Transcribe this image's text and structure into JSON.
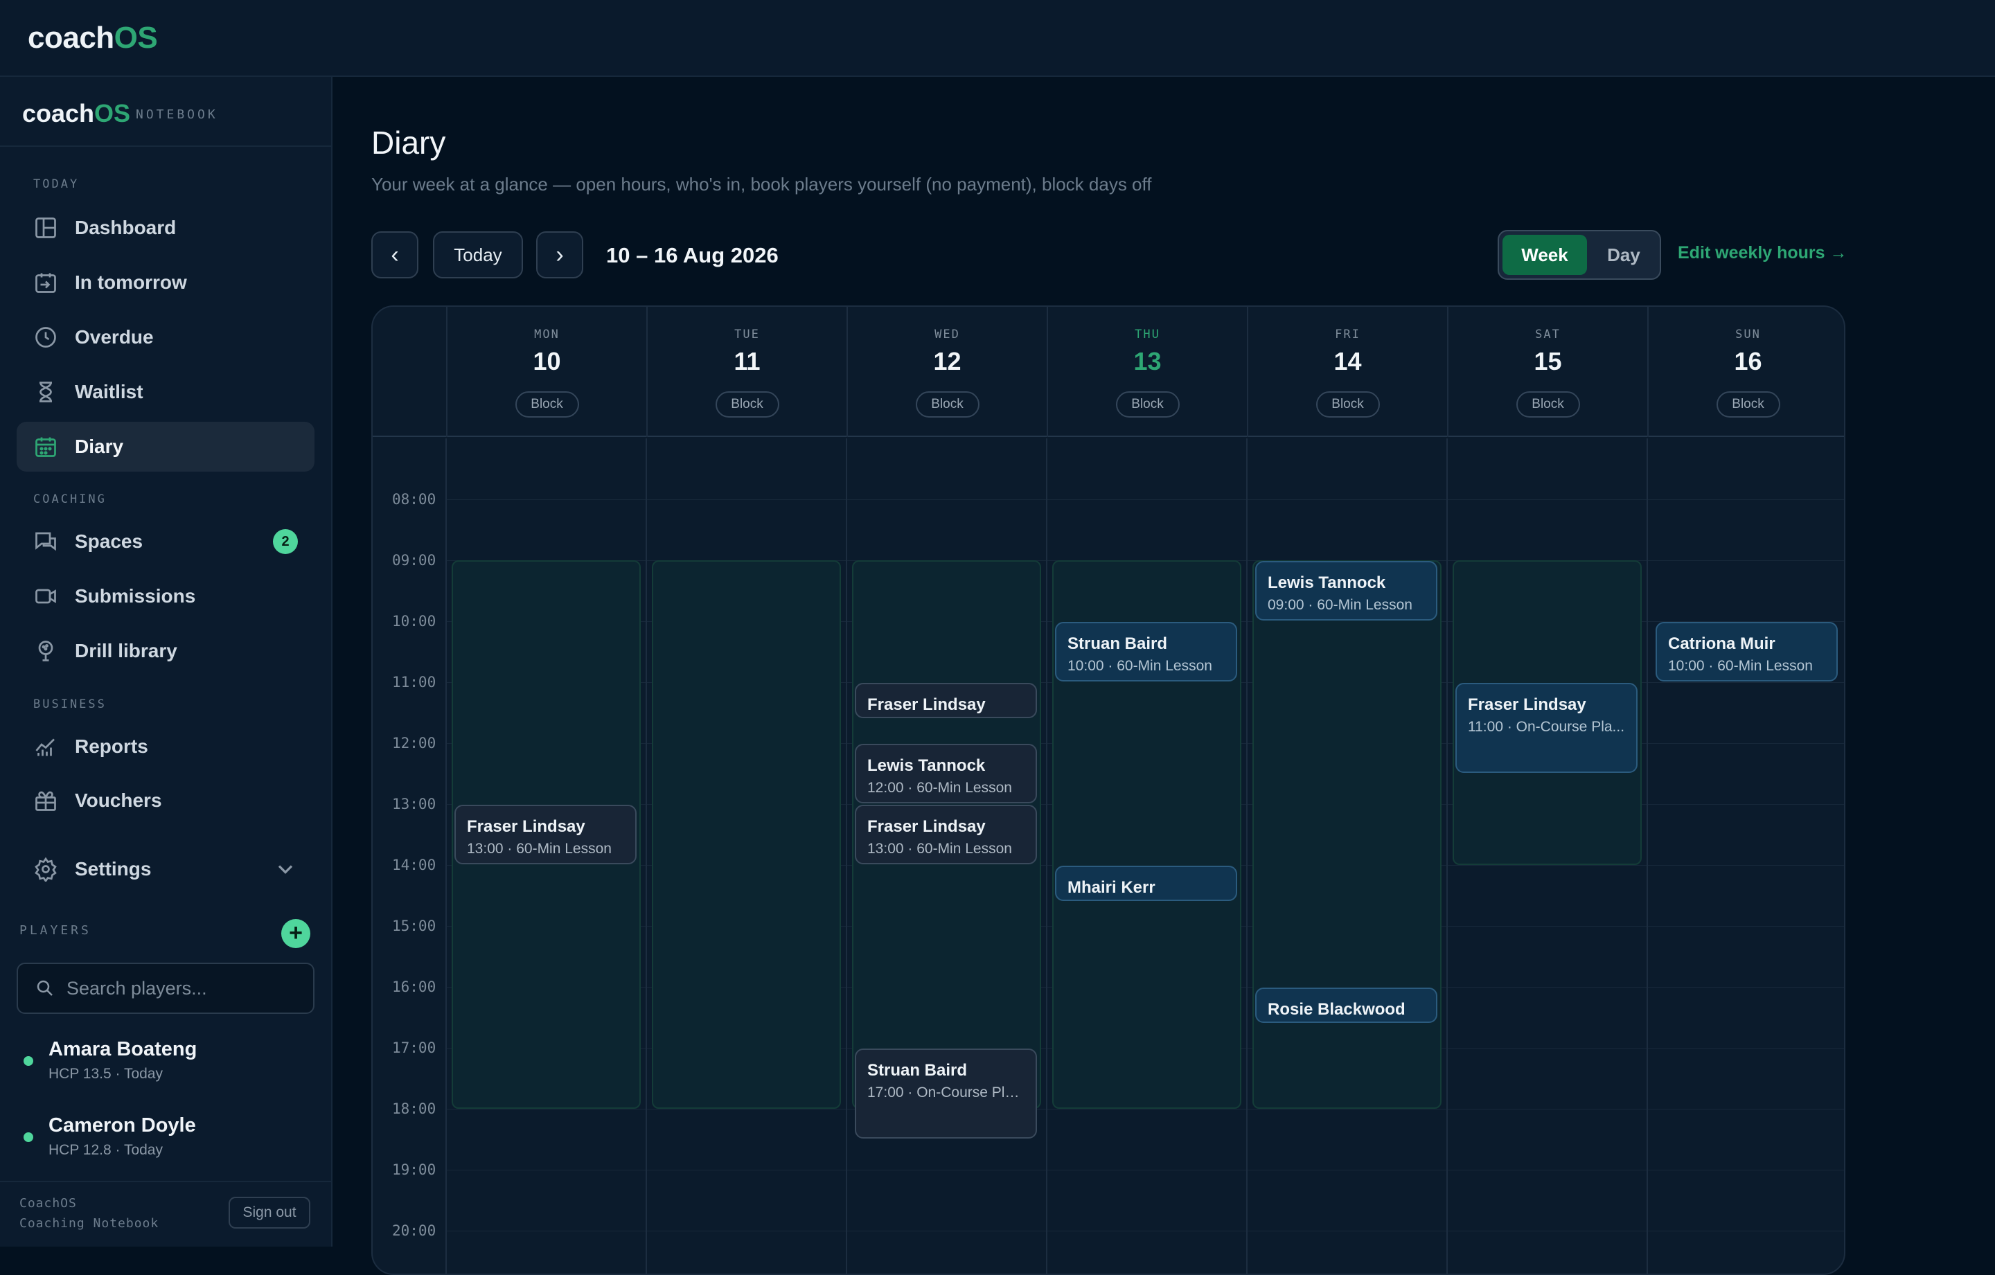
{
  "app": {
    "brand_prefix": "coach",
    "brand_suffix": "OS",
    "notebook_label": "NOTEBOOK"
  },
  "sidebar": {
    "sections": {
      "today": "TODAY",
      "coaching": "COACHING",
      "business": "BUSINESS"
    },
    "items": [
      {
        "label": "Dashboard"
      },
      {
        "label": "In tomorrow"
      },
      {
        "label": "Overdue"
      },
      {
        "label": "Waitlist"
      },
      {
        "label": "Diary"
      },
      {
        "label": "Spaces",
        "badge": "2"
      },
      {
        "label": "Submissions"
      },
      {
        "label": "Drill library"
      },
      {
        "label": "Reports"
      },
      {
        "label": "Vouchers"
      },
      {
        "label": "Settings"
      }
    ],
    "players_label": "PLAYERS",
    "add_symbol": "+",
    "search_placeholder": "Search players...",
    "players": [
      {
        "name": "Amara Boateng",
        "meta": "HCP 13.5 · Today"
      },
      {
        "name": "Cameron Doyle",
        "meta": "HCP 12.8 · Today"
      }
    ],
    "footer_line1": "CoachOS",
    "footer_line2": "Coaching Notebook",
    "sign_out": "Sign out"
  },
  "page": {
    "title": "Diary",
    "subtitle": "Your week at a glance — open hours, who's in, book players yourself (no payment), block days off",
    "prev_symbol": "‹",
    "today_label": "Today",
    "next_symbol": "›",
    "range": "10 – 16 Aug 2026",
    "view_week": "Week",
    "view_day": "Day",
    "edit_hours": "Edit weekly hours →"
  },
  "calendar": {
    "block_label": "Block",
    "days": [
      {
        "dow": "MON",
        "num": "10"
      },
      {
        "dow": "TUE",
        "num": "11"
      },
      {
        "dow": "WED",
        "num": "12"
      },
      {
        "dow": "THU",
        "num": "13",
        "today": true
      },
      {
        "dow": "FRI",
        "num": "14"
      },
      {
        "dow": "SAT",
        "num": "15"
      },
      {
        "dow": "SUN",
        "num": "16"
      }
    ],
    "hours": [
      "08:00",
      "09:00",
      "10:00",
      "11:00",
      "12:00",
      "13:00",
      "14:00",
      "15:00",
      "16:00",
      "17:00",
      "18:00",
      "19:00",
      "20:00"
    ],
    "open_hours": [
      {
        "day": 0,
        "start": 9,
        "end": 18
      },
      {
        "day": 1,
        "start": 9,
        "end": 18
      },
      {
        "day": 2,
        "start": 9,
        "end": 18
      },
      {
        "day": 3,
        "start": 9,
        "end": 18
      },
      {
        "day": 4,
        "start": 9,
        "end": 18
      },
      {
        "day": 5,
        "start": 9,
        "end": 14
      }
    ],
    "events": [
      {
        "day": 0,
        "start": 13,
        "end": 14,
        "name": "Fraser Lindsay",
        "detail": "13:00 · 60-Min Lesson",
        "style": "gray"
      },
      {
        "day": 2,
        "start": 11,
        "end": 11.6,
        "name": "Fraser Lindsay",
        "detail": "",
        "style": "gray"
      },
      {
        "day": 2,
        "start": 12,
        "end": 13,
        "name": "Lewis Tannock",
        "detail": "12:00 · 60-Min Lesson",
        "style": "gray"
      },
      {
        "day": 2,
        "start": 13,
        "end": 14,
        "name": "Fraser Lindsay",
        "detail": "13:00 · 60-Min Lesson",
        "style": "gray"
      },
      {
        "day": 2,
        "start": 17,
        "end": 18.5,
        "name": "Struan Baird",
        "detail": "17:00 · On-Course Pla...",
        "style": "gray"
      },
      {
        "day": 3,
        "start": 10,
        "end": 11,
        "name": "Struan Baird",
        "detail": "10:00 · 60-Min Lesson",
        "style": "blue"
      },
      {
        "day": 3,
        "start": 14,
        "end": 14.6,
        "name": "Mhairi Kerr",
        "detail": "",
        "style": "blue"
      },
      {
        "day": 4,
        "start": 9,
        "end": 10,
        "name": "Lewis Tannock",
        "detail": "09:00 · 60-Min Lesson",
        "style": "blue"
      },
      {
        "day": 4,
        "start": 16,
        "end": 16.6,
        "name": "Rosie Blackwood",
        "detail": "",
        "style": "blue"
      },
      {
        "day": 5,
        "start": 11,
        "end": 12.5,
        "name": "Fraser Lindsay",
        "detail": "11:00 · On-Course Pla...",
        "style": "blue"
      },
      {
        "day": 6,
        "start": 10,
        "end": 11,
        "name": "Catriona Muir",
        "detail": "10:00 · 60-Min Lesson",
        "style": "blue"
      }
    ]
  },
  "colors": {
    "accent": "#2ea774",
    "badge": "#4fd69c",
    "background": "#03111f"
  }
}
